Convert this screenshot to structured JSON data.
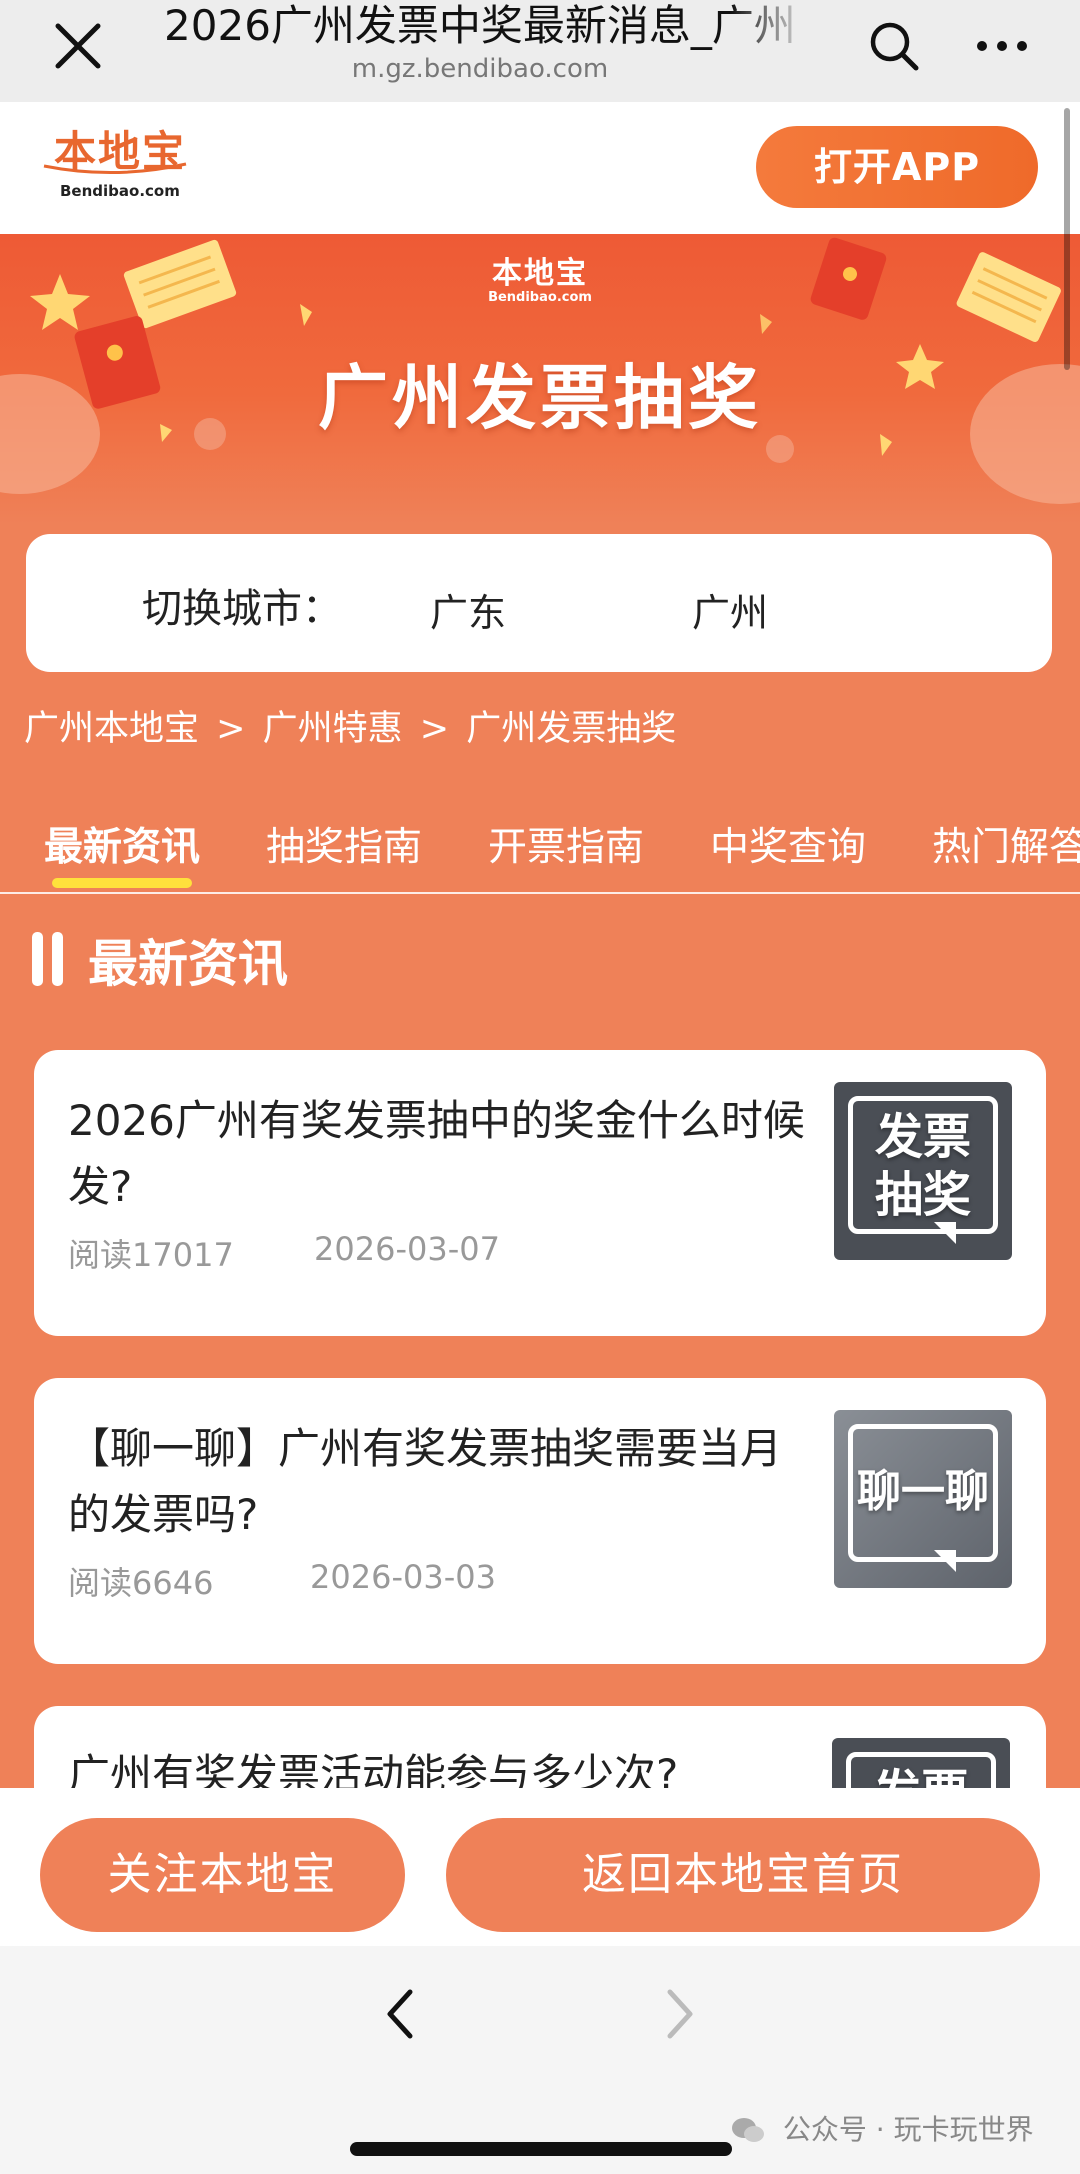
{
  "browser": {
    "title": "2026广州发票中奖最新消息_广州",
    "url": "m.gz.bendibao.com",
    "icons": [
      "close-icon",
      "search-icon",
      "more-icon"
    ]
  },
  "header": {
    "logo_cn": "本地宝",
    "logo_en": "Bendibao.com",
    "open_app": "打开APP"
  },
  "banner": {
    "logo_cn": "本地宝",
    "logo_en": "Bendibao.com",
    "title": "广州发票抽奖"
  },
  "city_switch": {
    "label": "切换城市：",
    "province": "广东",
    "city": "广州"
  },
  "breadcrumb": [
    "广州本地宝",
    ">",
    "广州特惠",
    ">",
    "广州发票抽奖"
  ],
  "tabs": [
    {
      "label": "最新资讯",
      "active": true
    },
    {
      "label": "抽奖指南",
      "active": false
    },
    {
      "label": "开票指南",
      "active": false
    },
    {
      "label": "中奖查询",
      "active": false
    },
    {
      "label": "热门解答",
      "active": false
    }
  ],
  "section_title": "最新资讯",
  "articles": [
    {
      "title": "2026广州有奖发票抽中的奖金什么时候发?",
      "reads": "阅读17017",
      "date": "2026-03-07",
      "thumb_lines": [
        "发票",
        "抽奖"
      ]
    },
    {
      "title": "【聊一聊】广州有奖发票抽奖需要当月的发票吗?",
      "reads": "阅读6646",
      "date": "2026-03-03",
      "thumb_lines": [
        "聊一聊"
      ]
    },
    {
      "title": "广州有奖发票活动能参与多少次?",
      "thumb_lines": [
        "发票"
      ]
    }
  ],
  "actions": {
    "follow": "关注本地宝",
    "home": "返回本地宝首页"
  },
  "watermark": {
    "text": "公众号 · 玩卡玩世界"
  },
  "colors": {
    "brand_orange": "#ef8158",
    "banner_red": "#ee5a35",
    "tab_underline": "#ffe13c"
  }
}
